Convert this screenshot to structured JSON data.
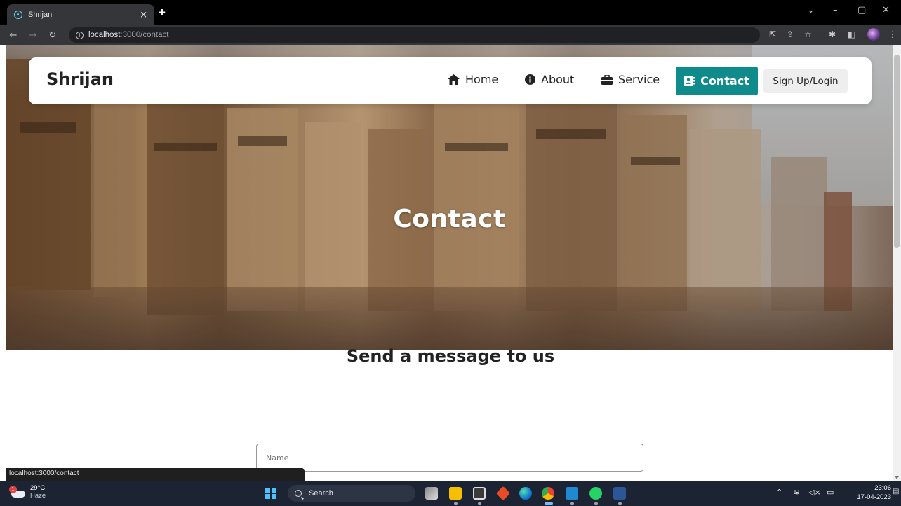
{
  "browser": {
    "tab_title": "Shrijan",
    "tab_close": "×",
    "new_tab": "+",
    "url_host": "localhost",
    "url_path": ":3000/contact",
    "status_url": "localhost:3000/contact"
  },
  "navbar": {
    "brand": "Shrijan",
    "links": {
      "home": "Home",
      "about": "About",
      "service": "Service",
      "contact": "Contact"
    },
    "login": "Sign Up/Login",
    "accent_color": "#108b8b"
  },
  "hero": {
    "title": "Contact"
  },
  "form": {
    "heading": "Send a message to us",
    "name_placeholder": "Name"
  },
  "taskbar": {
    "weather_temp": "29°C",
    "weather_desc": "Haze",
    "weather_badge": "1",
    "search_label": "Search",
    "time": "23:06",
    "date": "17-04-2023"
  }
}
